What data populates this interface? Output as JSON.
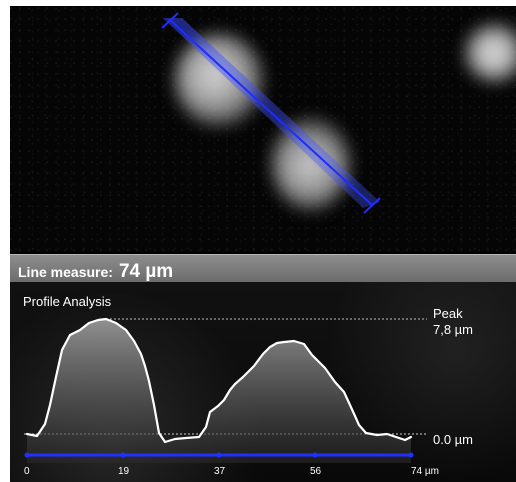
{
  "measurement": {
    "label": "Line measure:",
    "value": "74 µm"
  },
  "profile": {
    "title": "Profile Analysis",
    "peak_label": "Peak",
    "peak_value": "7,8 µm",
    "baseline_label": "0.0 µm",
    "axis_ticks": [
      "0",
      "19",
      "37",
      "56",
      "74 µm"
    ]
  },
  "colors": {
    "measurement_line": "#1f2dff",
    "axis": "#2230ff",
    "profile_line": "#ffffff",
    "panel_bar": "#7d7d7d"
  }
}
